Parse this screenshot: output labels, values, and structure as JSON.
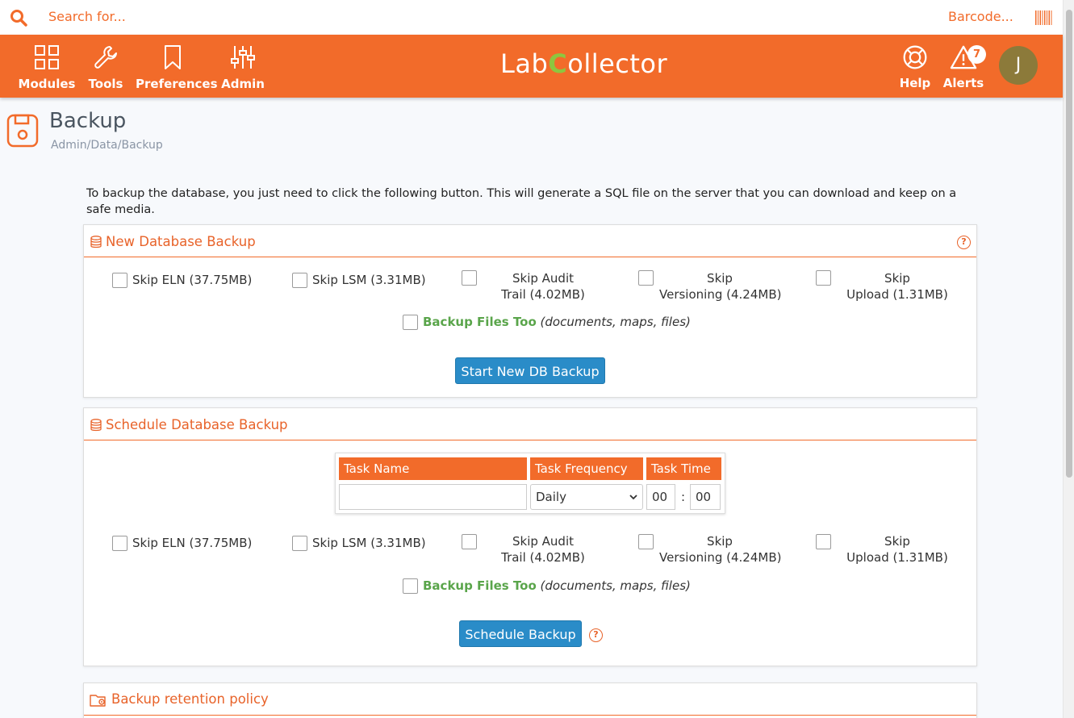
{
  "search": {
    "placeholder": "Search for...",
    "barcode": "Barcode..."
  },
  "nav": {
    "items": [
      {
        "label": "Modules"
      },
      {
        "label": "Tools"
      },
      {
        "label": "Preferences"
      },
      {
        "label": "Admin"
      }
    ],
    "logo": {
      "pre": "Lab",
      "c": "C",
      "post": "ollector"
    },
    "help": "Help",
    "alerts": "Alerts",
    "alert_count": "7",
    "avatar_initial": "J"
  },
  "page": {
    "title": "Backup",
    "breadcrumb": "Admin/Data/Backup",
    "intro": "To backup the database, you just need to click the following button. This will generate a SQL file on the server that you can download and keep on a safe media."
  },
  "new_backup": {
    "title": "New Database Backup",
    "skip_eln": "Skip ELN (37.75MB)",
    "skip_lsm": "Skip LSM (3.31MB)",
    "skip_audit_1": "Skip Audit",
    "skip_audit_2": "Trail (4.02MB)",
    "skip_versioning_1": "Skip",
    "skip_versioning_2": "Versioning (4.24MB)",
    "skip_upload_1": "Skip",
    "skip_upload_2": "Upload (1.31MB)",
    "files_strong": "Backup Files Too",
    "files_em": "(documents, maps, files)",
    "button": "Start New DB Backup"
  },
  "schedule_backup": {
    "title": "Schedule Database Backup",
    "col_task_name": "Task Name",
    "col_frequency": "Task Frequency",
    "col_time": "Task Time",
    "task_name_value": "",
    "frequency_value": "Daily",
    "hour": "00",
    "minute": "00",
    "skip_eln": "Skip ELN (37.75MB)",
    "skip_lsm": "Skip LSM (3.31MB)",
    "skip_audit_1": "Skip Audit",
    "skip_audit_2": "Trail (4.02MB)",
    "skip_versioning_1": "Skip",
    "skip_versioning_2": "Versioning (4.24MB)",
    "skip_upload_1": "Skip",
    "skip_upload_2": "Upload (1.31MB)",
    "files_strong": "Backup Files Too",
    "files_em": "(documents, maps, files)",
    "button": "Schedule Backup"
  },
  "retention": {
    "title": "Backup retention policy"
  },
  "colors": {
    "accent": "#f26b2a",
    "button": "#2a8cc8",
    "green": "#5aa54b"
  }
}
